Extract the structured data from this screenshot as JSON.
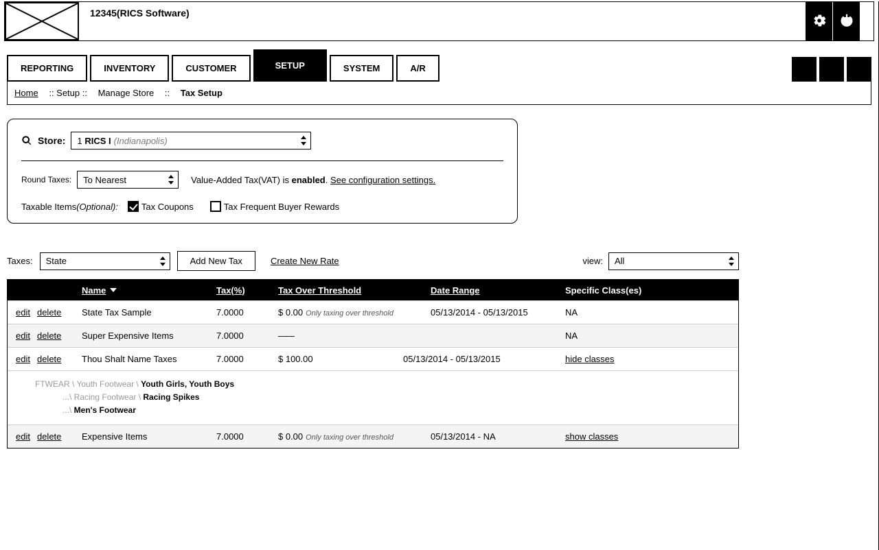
{
  "header": {
    "title": "12345(RICS Software)"
  },
  "tabs": {
    "reporting": "REPORTING",
    "inventory": "INVENTORY",
    "customer": "CUSTOMER",
    "setup": "SETUP",
    "system": "SYSTEM",
    "ar": "A/R"
  },
  "breadcrumb": {
    "home": "Home",
    "sep1": ":: Setup ::",
    "seg2": "Manage Store",
    "sep2": "::",
    "current": "Tax Setup"
  },
  "panel": {
    "store_label": "Store:",
    "store_num": "1",
    "store_name": "RICS I",
    "store_city": "(Indianapolis)",
    "round_label": "Round Taxes:",
    "round_value": "To Nearest",
    "vat_prefix": "Value-Added Tax(VAT) is ",
    "vat_state": "enabled",
    "vat_suffix": ". ",
    "vat_link": "See configuration settings.",
    "taxable_label": "Taxable Items ",
    "taxable_optional": "(Optional):",
    "chk_coupons_label": "Tax Coupons",
    "chk_rewards_label": "Tax Frequent Buyer Rewards"
  },
  "taxbar": {
    "label": "Taxes:",
    "select_value": "State",
    "add_button": "Add New Tax",
    "create_link": "Create New Rate",
    "view_label": "view:",
    "view_value": "All"
  },
  "thead": {
    "name": "Name",
    "tax": "Tax(%)",
    "over": "Tax Over Threshold",
    "date": "Date Range",
    "class": "Specific Class(es)"
  },
  "rows": [
    {
      "edit": "edit",
      "del": "delete",
      "name": "State Tax Sample",
      "tax": "7.0000",
      "over": "$ 0.00",
      "over_note": "Only taxing over threshold",
      "date": "05/13/2014 - 05/13/2015",
      "class_text": "NA"
    },
    {
      "edit": "edit",
      "del": "delete",
      "name": "Super Expensive Items",
      "tax": "7.0000",
      "over": "——",
      "over_note": "",
      "date": "",
      "class_text": "NA"
    },
    {
      "edit": "edit",
      "del": "delete",
      "name": "Thou Shalt Name Taxes",
      "tax": "7.0000",
      "over": "$ 100.00",
      "over_note": "",
      "date": "05/13/2014 - 05/13/2015",
      "class_link": "hide classes"
    },
    {
      "edit": "edit",
      "del": "delete",
      "name": "Expensive Items",
      "tax": "7.0000",
      "over": "$ 0.00",
      "over_note": "Only taxing over threshold",
      "date": "05/13/2014 - NA",
      "class_link": "show classes"
    }
  ],
  "class_tree": {
    "l1_light": "FTWEAR \\ Youth Footwear \\ ",
    "l1_bold": "Youth Girls, Youth Boys",
    "l2_light": "...\\ Racing Footwear \\ ",
    "l2_bold": "Racing Spikes",
    "l3_light": "...\\ ",
    "l3_bold": "Men's Footwear"
  }
}
